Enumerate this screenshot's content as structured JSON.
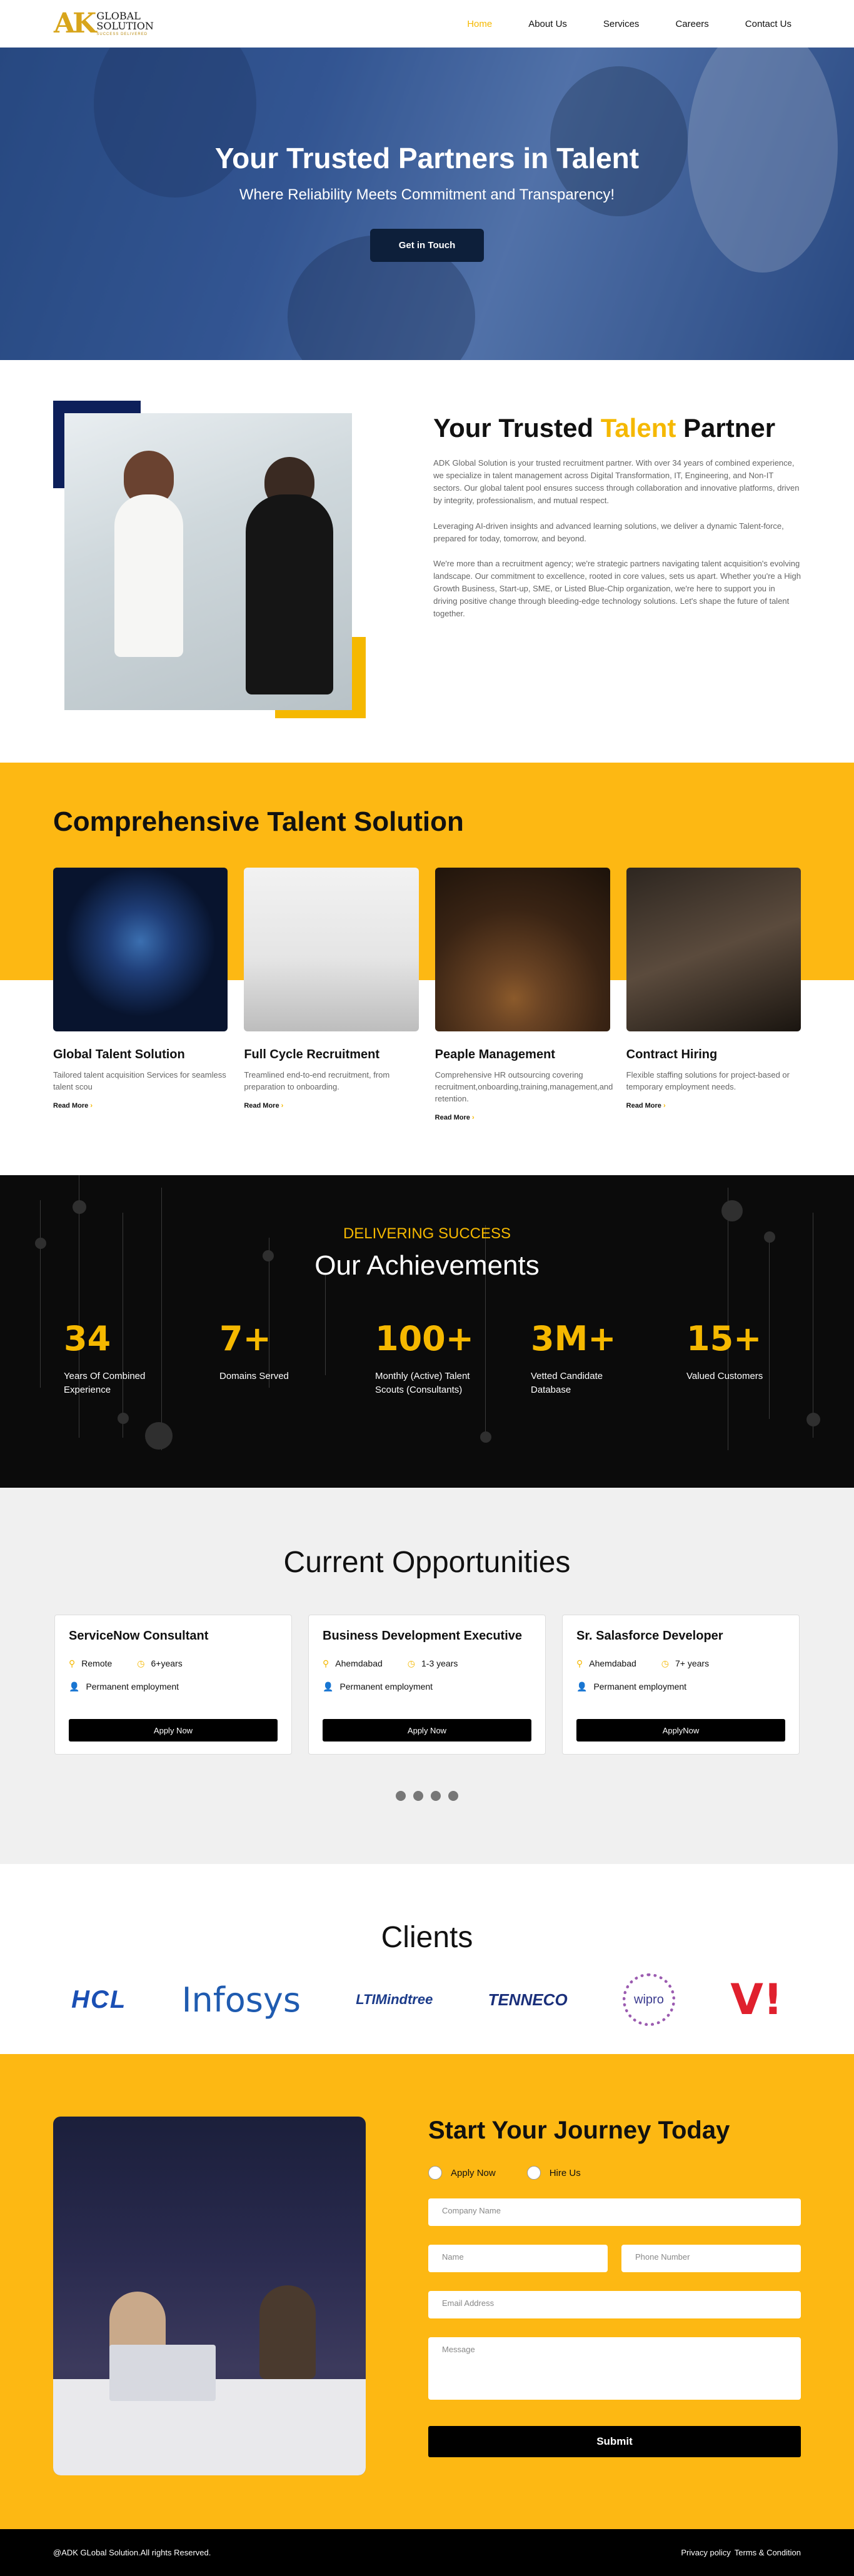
{
  "nav": {
    "logo_mark": "AK",
    "logo_line1": "GLOBAL",
    "logo_line2": "SOLUTION",
    "logo_tagline": "SUCCESS DELIVERED",
    "items": [
      "Home",
      "About Us",
      "Services",
      "Careers",
      "Contact Us"
    ]
  },
  "hero": {
    "title": "Your Trusted Partners in Talent",
    "subtitle": "Where Reliability Meets Commitment and Transparency!",
    "cta": "Get in Touch"
  },
  "about": {
    "title_pre": "Your Trusted ",
    "title_highlight": "Talent",
    "title_post": " Partner",
    "paragraphs": [
      "ADK Global Solution is your trusted recruitment partner. With over 34 years of combined experience, we specialize in talent management across Digital Transformation, IT, Engineering, and Non-IT sectors. Our global talent pool ensures success through collaboration and innovative platforms, driven by integrity, professionalism, and mutual respect.",
      "Leveraging AI-driven insights and advanced learning solutions, we deliver a dynamic Talent-force, prepared for today, tomorrow, and beyond.",
      "We're more than a recruitment agency; we're strategic partners navigating talent acquisition's evolving landscape. Our commitment to excellence, rooted in core values, sets us apart. Whether you're a High Growth Business, Start-up, SME, or Listed Blue-Chip organization, we're here to support you in driving positive change through bleeding-edge technology solutions. Let's shape the future of talent together."
    ]
  },
  "services": {
    "title": "Comprehensive Talent Solution",
    "read_more": "Read More",
    "cards": [
      {
        "title": "Global Talent Solution",
        "desc": "Tailored talent acquisition Services for seamless talent scou"
      },
      {
        "title": "Full Cycle Recruitment",
        "desc": "Treamlined end-to-end recruitment, from preparation to onboarding."
      },
      {
        "title": "Peaple Management",
        "desc": "Comprehensive HR outsourcing covering recruitment,onboarding,training,management,and retention."
      },
      {
        "title": "Contract Hiring",
        "desc": "Flexible staffing solutions for project-based or temporary employment needs."
      }
    ]
  },
  "achievements": {
    "eyebrow": "DELIVERING SUCCESS",
    "title": "Our Achievements",
    "stats": [
      {
        "num": "34",
        "label": "Years Of Combined Experience"
      },
      {
        "num": "7+",
        "label": "Domains Served"
      },
      {
        "num": "100+",
        "label": "Monthly (Active) Talent Scouts (Consultants)"
      },
      {
        "num": "3M+",
        "label": "Vetted Candidate Database"
      },
      {
        "num": "15+",
        "label": "Valued Customers"
      }
    ]
  },
  "opportunities": {
    "title": "Current Opportunities",
    "jobs": [
      {
        "title": "ServiceNow Consultant",
        "location": "Remote",
        "exp": "6+years",
        "type": "Permanent employment",
        "apply": "Apply Now"
      },
      {
        "title": "Business Development Executive",
        "location": "Ahemdabad",
        "exp": "1-3 years",
        "type": "Permanent employment",
        "apply": "Apply Now"
      },
      {
        "title": "Sr. Salasforce Developer",
        "location": "Ahemdabad",
        "exp": "7+ years",
        "type": "Permanent employment",
        "apply": "ApplyNow"
      }
    ]
  },
  "clients": {
    "title": "Clients",
    "logos": [
      "HCL",
      "Infosys",
      "LTIMindtree",
      "TENNECO",
      "wipro",
      "V!"
    ]
  },
  "contact": {
    "title": "Start Your Journey Today",
    "radio_apply": "Apply Now",
    "radio_hire": "Hire Us",
    "company_placeholder": "Company Name",
    "name_placeholder": "Name",
    "phone_placeholder": "Phone Number",
    "email_placeholder": "Email Address",
    "message_placeholder": "Message",
    "submit": "Submit"
  },
  "footer": {
    "copyright": "@ADK GLobal Solution.All rights Reserved.",
    "privacy": "Privacy policy",
    "terms": "Terms & Condition"
  },
  "colors": {
    "accent": "#f5b800",
    "dark": "#0b0b0b",
    "navy": "#0d1f5a"
  }
}
